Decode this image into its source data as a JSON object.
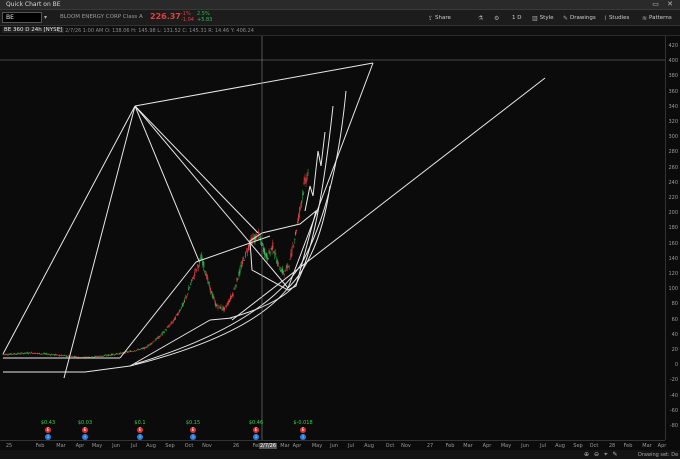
{
  "window": {
    "title": "Quick Chart on BE",
    "controls": "▭ ✕"
  },
  "toolbar": {
    "symbol": "BE",
    "company": "BLOOM ENERGY CORP Class A",
    "last_price": "226.37",
    "change_top": "-1%",
    "change_bottom": "-1.04",
    "change2_top": "2.5%",
    "change2_bottom": "+5.83",
    "share_label": "Share",
    "interval_label": "1 D",
    "style_label": "Style",
    "drawings_label": "Drawings",
    "studies_label": "Studies",
    "patterns_label": "Patterns"
  },
  "header": {
    "study": "BE 360 D 24h [NYSE]",
    "ohlc": "D: 2/7/26 1:00 AM   O: 138.06   H: 145.98   L: 131.52   C: 145.31   R: 14.46   Y: 406.24"
  },
  "colors": {
    "up": "#2fbf4f",
    "down": "#e04040",
    "lines": "#e8e8e8",
    "bg": "#0b0b0b"
  },
  "y_ticks": [
    "420",
    "400",
    "380",
    "360",
    "340",
    "320",
    "300",
    "280",
    "260",
    "240",
    "220",
    "200",
    "180",
    "160",
    "140",
    "120",
    "100",
    "80",
    "60",
    "40",
    "20",
    "0",
    "-20",
    "-40",
    "-60",
    "-80"
  ],
  "x_ticks": [
    "25",
    "Feb",
    "Mar",
    "Apr",
    "May",
    "Jun",
    "Jul",
    "Aug",
    "Sep",
    "Oct",
    "Nov",
    "26",
    "Feb",
    "Mar",
    "Apr",
    "May",
    "Jun",
    "Jul",
    "Aug",
    "Oct",
    "Nov",
    "27",
    "Feb",
    "Mar",
    "Apr",
    "May",
    "Jun",
    "Jul",
    "Aug",
    "Sep",
    "Oct",
    "28",
    "Feb",
    "Mar",
    "Apr"
  ],
  "x_highlight": "2/7/26",
  "events": [
    {
      "label": "$0.43"
    },
    {
      "label": "$0.03"
    },
    {
      "label": "$0.1"
    },
    {
      "label": "$0.15"
    },
    {
      "label": "$0.46"
    },
    {
      "label": "$-0.018"
    }
  ],
  "status": {
    "drawing_set": "Drawing set: De"
  },
  "chart_data": {
    "type": "line",
    "ylim": [
      -80,
      430
    ],
    "price_path": [
      [
        0,
        28
      ],
      [
        20,
        30
      ],
      [
        40,
        27
      ],
      [
        55,
        24
      ],
      [
        70,
        26
      ],
      [
        85,
        30
      ],
      [
        100,
        36
      ],
      [
        110,
        50
      ],
      [
        120,
        70
      ],
      [
        128,
        95
      ],
      [
        135,
        130
      ],
      [
        140,
        150
      ],
      [
        146,
        110
      ],
      [
        150,
        90
      ],
      [
        156,
        85
      ],
      [
        162,
        105
      ],
      [
        168,
        140
      ],
      [
        174,
        170
      ],
      [
        180,
        178
      ],
      [
        186,
        150
      ],
      [
        190,
        165
      ],
      [
        194,
        140
      ],
      [
        198,
        130
      ],
      [
        202,
        145
      ],
      [
        206,
        180
      ],
      [
        209,
        210
      ],
      [
        212,
        240
      ],
      [
        215,
        260
      ]
    ]
  }
}
